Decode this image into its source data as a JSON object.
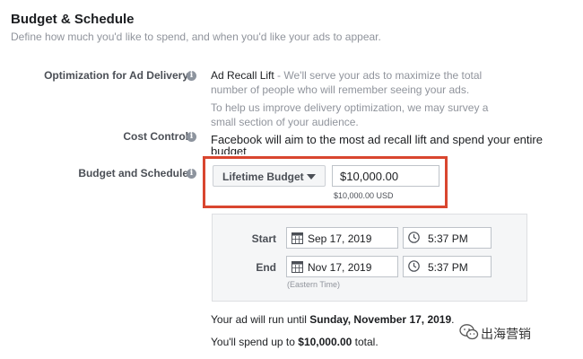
{
  "section": {
    "title": "Budget & Schedule",
    "subtitle": "Define how much you'd like to spend, and when you'd like your ads to appear."
  },
  "optimization": {
    "label": "Optimization for Ad Delivery",
    "value": "Ad Recall Lift",
    "description_line1": " - We'll serve your ads to maximize the total",
    "description_line2": "number of people who will remember seeing your ads.",
    "note_line1": "To help us improve delivery optimization, we may survey a",
    "note_line2": "small section of your audience."
  },
  "cost_control": {
    "label": "Cost Control",
    "text_line1": "Facebook will aim to the most ad recall lift and spend your entire",
    "text_line2": "budget"
  },
  "budget": {
    "label": "Budget and Schedule",
    "type": "Lifetime Budget",
    "amount": "$10,000.00",
    "amount_currency": "$10,000.00 USD"
  },
  "schedule": {
    "start_label": "Start",
    "start_date": "Sep 17, 2019",
    "start_time": "5:37 PM",
    "end_label": "End",
    "end_date": "Nov 17, 2019",
    "end_time": "5:37 PM",
    "timezone": "(Eastern Time)"
  },
  "summary": {
    "run_prefix": "Your ad will run until ",
    "run_date": "Sunday, November 17, 2019",
    "run_suffix": ".",
    "spend_prefix": "You'll spend up to ",
    "spend_amount": "$10,000.00",
    "spend_suffix": " total."
  },
  "watermark": {
    "text": "出海营销",
    "icon": "wechat-icon"
  },
  "colors": {
    "highlight": "#d9462f",
    "info_icon": "#8d949e",
    "muted_text": "#90949c"
  }
}
